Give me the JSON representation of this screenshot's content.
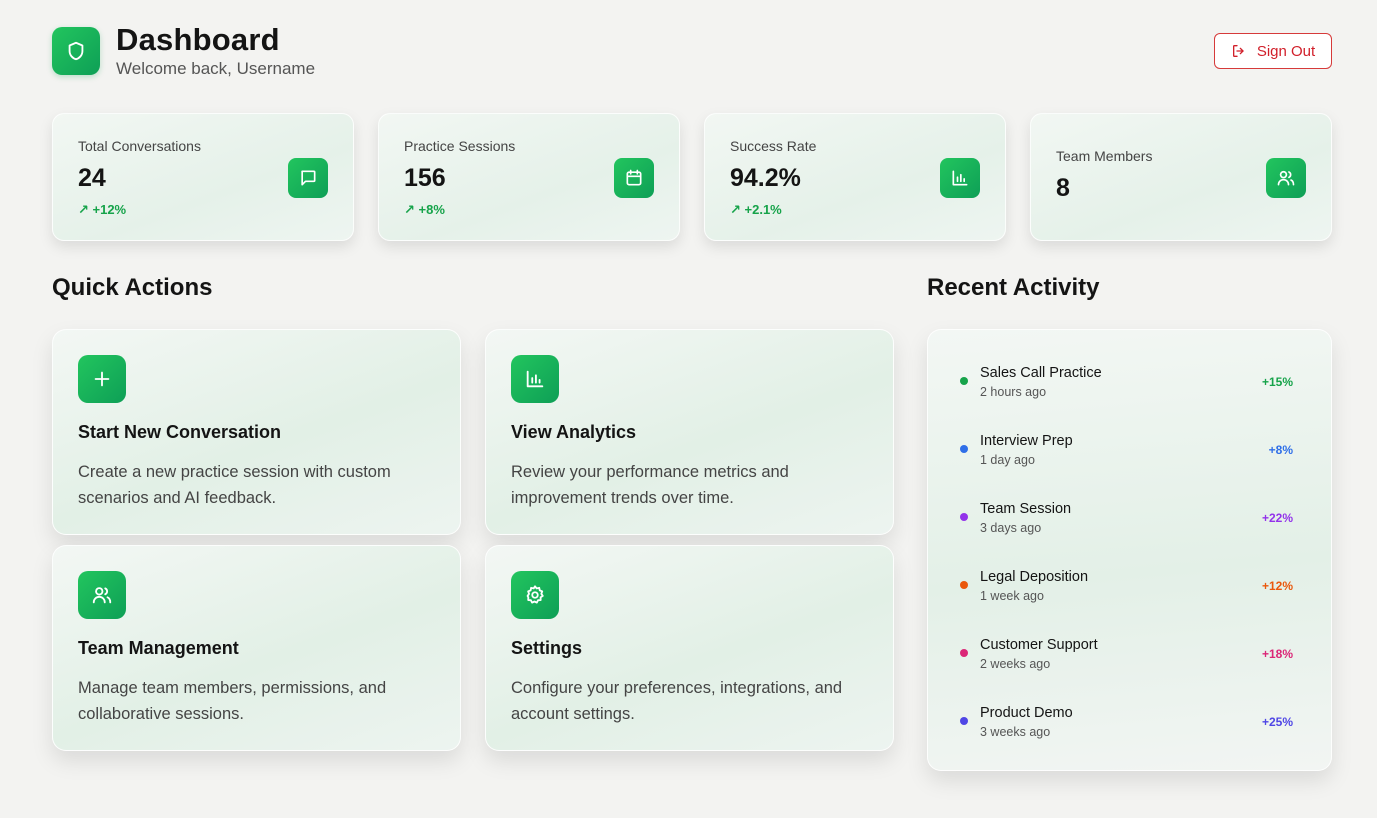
{
  "header": {
    "title": "Dashboard",
    "subtitle": "Welcome back, Username",
    "logo_icon": "shield-icon",
    "signout_label": "Sign Out",
    "signout_icon": "log-out-icon",
    "signout_color": "#d11f2a"
  },
  "stats": [
    {
      "label": "Total Conversations",
      "value": "24",
      "change": "↗ +12%",
      "icon": "message-square-icon"
    },
    {
      "label": "Practice Sessions",
      "value": "156",
      "change": "↗ +8%",
      "icon": "calendar-icon"
    },
    {
      "label": "Success Rate",
      "value": "94.2%",
      "change": "↗ +2.1%",
      "icon": "bar-chart-icon"
    },
    {
      "label": "Team Members",
      "value": "8",
      "icon": "users-icon"
    }
  ],
  "quick_actions": {
    "title": "Quick Actions",
    "items": [
      {
        "title": "Start New Conversation",
        "description": "Create a new practice session with custom scenarios and AI feedback.",
        "icon": "plus-icon"
      },
      {
        "title": "View Analytics",
        "description": "Review your performance metrics and improvement trends over time.",
        "icon": "bar-chart-icon"
      },
      {
        "title": "Team Management",
        "description": "Manage team members, permissions, and collaborative sessions.",
        "icon": "users-icon"
      },
      {
        "title": "Settings",
        "description": "Configure your preferences, integrations, and account settings.",
        "icon": "gear-icon"
      }
    ]
  },
  "recent_activity": {
    "title": "Recent Activity",
    "items": [
      {
        "name": "Sales Call Practice",
        "time": "2 hours ago",
        "delta": "+15%",
        "color": "#16a34a"
      },
      {
        "name": "Interview Prep",
        "time": "1 day ago",
        "delta": "+8%",
        "color": "#2f6fe8"
      },
      {
        "name": "Team Session",
        "time": "3 days ago",
        "delta": "+22%",
        "color": "#9333ea"
      },
      {
        "name": "Legal Deposition",
        "time": "1 week ago",
        "delta": "+12%",
        "color": "#ea580c"
      },
      {
        "name": "Customer Support",
        "time": "2 weeks ago",
        "delta": "+18%",
        "color": "#db2777"
      },
      {
        "name": "Product Demo",
        "time": "3 weeks ago",
        "delta": "+25%",
        "color": "#4f46e5"
      }
    ]
  },
  "colors": {
    "accent": "#16a34a",
    "background": "#f3f3f1"
  }
}
